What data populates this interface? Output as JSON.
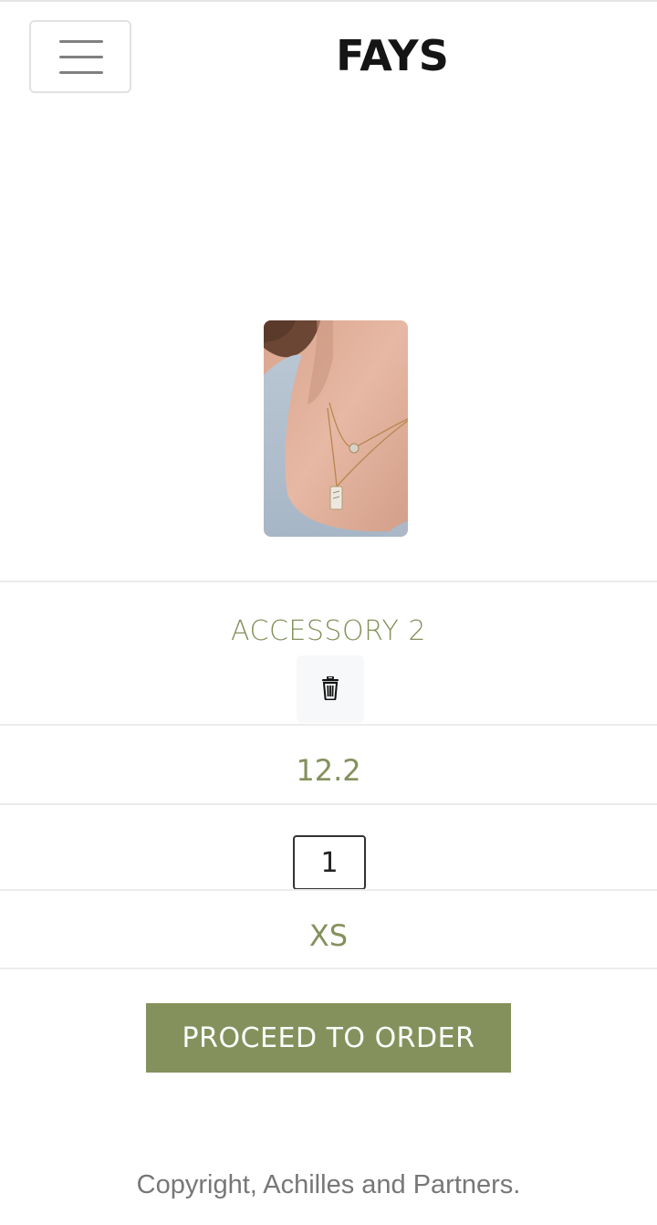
{
  "header": {
    "brand": "FAYS",
    "menu_icon": "hamburger-menu-icon"
  },
  "product": {
    "image_alt": "necklace-photo",
    "name": "ACCESSORY 2",
    "delete_icon": "trash-icon",
    "price": "12.2",
    "quantity": "1",
    "size": "XS"
  },
  "actions": {
    "proceed_label": "PROCEED TO ORDER"
  },
  "footer": {
    "copyright": "Copyright, Achilles and Partners."
  },
  "colors": {
    "accent": "#84915c",
    "brand_text": "#151515",
    "footer_text": "#777777"
  }
}
